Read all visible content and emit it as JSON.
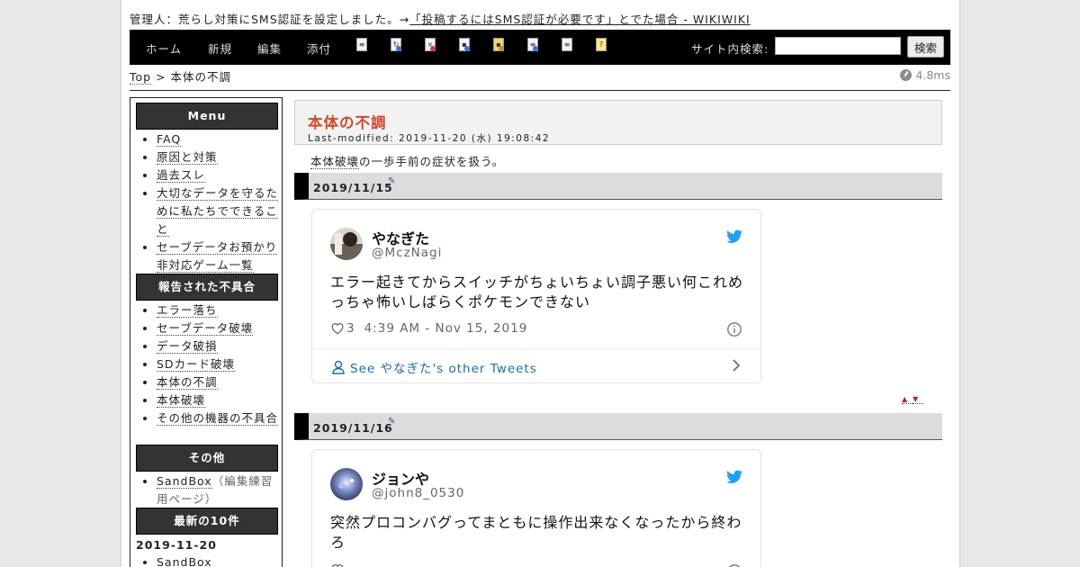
{
  "notice": {
    "prefix": "管理人：荒らし対策にSMS認証を設定しました。→",
    "link": "「投稿するにはSMS認証が必要です」とでた場合 - WIKIWIKI"
  },
  "nav": {
    "links": [
      "ホーム",
      "新規",
      "編集",
      "添付"
    ],
    "tools": [
      "page-icon",
      "reload-icon",
      "delete-icon",
      "save-icon",
      "lock-icon",
      "copy-icon",
      "list-icon",
      "help-icon"
    ],
    "search_label": "サイト内検索:",
    "search_value": "",
    "search_button": "検索"
  },
  "breadcrumb": {
    "top": "Top",
    "sep": ">",
    "current": "本体の不調"
  },
  "timing": "4.8ms",
  "sidebar": {
    "sections": [
      {
        "title": "Menu",
        "items": [
          "FAQ",
          "原因と対策",
          "過去スレ",
          "大切なデータを守るために私たちでできること",
          "セーブデータお預かり非対応ゲーム一覧"
        ]
      },
      {
        "title": "報告された不具合",
        "items": [
          "エラー落ち",
          "セーブデータ破壊",
          "データ破損",
          "SDカード破壊",
          "本体の不調",
          "本体破壊",
          "その他の機器の不具合"
        ]
      },
      {
        "title": "その他",
        "items": [
          "SandBox"
        ],
        "note": "（編集練習用ページ）"
      },
      {
        "title": "最新の10件",
        "date": "2019-11-20",
        "items": [
          "SandBox"
        ]
      }
    ]
  },
  "main": {
    "title": "本体の不調",
    "last_modified": "Last-modified: 2019-11-20 (水) 19:08:42",
    "intro_link": "本体破壊",
    "intro_text": "の一歩手前の症状を扱う。",
    "sections": [
      {
        "heading": "2019/11/15",
        "tweet": {
          "name": "やなぎた",
          "handle": "@MczNagi",
          "text": "エラー起きてからスイッチがちょいちょい調子悪い何これめっちゃ怖いしばらくポケモンできない",
          "likes": "3",
          "time": "4:39 AM - Nov 15, 2019",
          "more": "See やなぎた's other Tweets"
        }
      },
      {
        "heading": "2019/11/16",
        "tweet": {
          "name": "ジョンや",
          "handle": "@john8_0530",
          "text": "突然プロコンバグってまともに操作出来なくなったから終わろ",
          "likes": "",
          "time": ""
        }
      }
    ],
    "nav_arrows": [
      "▲",
      "▼"
    ]
  },
  "colors": {
    "accent_title": "#d04a2a",
    "link_blue": "#1b6ea8",
    "twitter_blue": "#1da1f2",
    "navbar": "#000000"
  }
}
